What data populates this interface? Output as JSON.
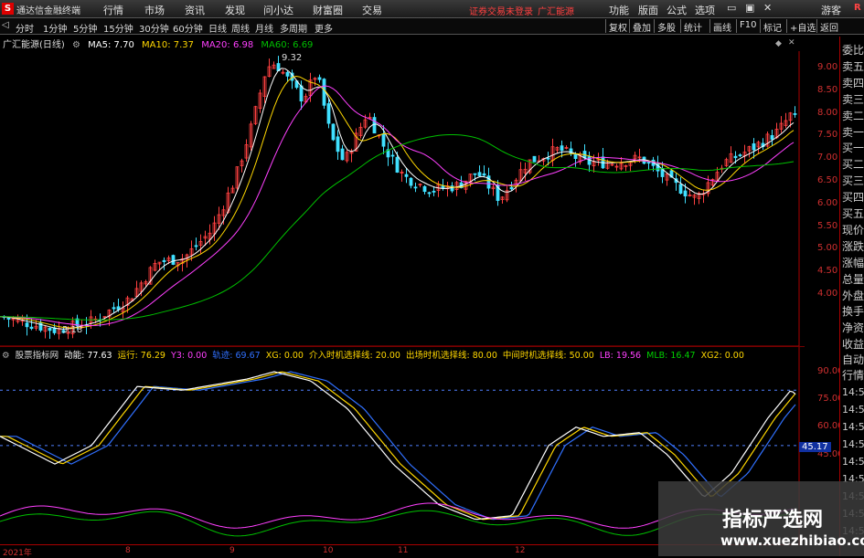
{
  "menubar": {
    "app_name": "通达信金融终端",
    "menu": [
      "行情",
      "市场",
      "资讯",
      "发现",
      "问小达",
      "财富圈",
      "交易"
    ],
    "warning1": "证券交易未登录",
    "warning2": "广汇能源",
    "right_menu": [
      "功能",
      "版面",
      "公式",
      "选项"
    ],
    "right_extra": "游客"
  },
  "toolbar": {
    "periods": [
      "分时",
      "1分钟",
      "5分钟",
      "15分钟",
      "30分钟",
      "60分钟",
      "日线",
      "周线",
      "月线",
      "多周期",
      "更多"
    ],
    "right_buttons": [
      "复权",
      "叠加",
      "多股",
      "统计",
      "画线",
      "F10",
      "标记",
      "+自选",
      "返回"
    ]
  },
  "main_chart": {
    "stock_name": "广汇能源(日线)",
    "ma5": "MA5: 7.70",
    "ma10": "MA10: 7.37",
    "ma20": "MA20: 6.98",
    "ma60": "MA60: 6.69",
    "high_label": "9.32",
    "low_label": "3.18",
    "y_ticks": [
      "9.00",
      "8.50",
      "8.00",
      "7.50",
      "7.00",
      "6.50",
      "6.00",
      "5.50",
      "5.00",
      "4.50",
      "4.00"
    ],
    "colors": {
      "ma5": "#ffffff",
      "ma10": "#ffd700",
      "ma20": "#ff40ff",
      "ma60": "#00c000",
      "up": "#ff4040",
      "down": "#40e0ff"
    }
  },
  "indicator": {
    "name": "股票指标网",
    "items": [
      {
        "label": "动能: 77.63",
        "color": "#ffffff"
      },
      {
        "label": "运行: 76.29",
        "color": "#ffd700"
      },
      {
        "label": "Y3: 0.00",
        "color": "#ff40ff"
      },
      {
        "label": "轨迹: 69.67",
        "color": "#3070ff"
      },
      {
        "label": "XG: 0.00",
        "color": "#ffd700"
      },
      {
        "label": "介入时机选择线: 20.00",
        "color": "#ffd700"
      },
      {
        "label": "出场时机选择线: 80.00",
        "color": "#ffd700"
      },
      {
        "label": "中间时机选择线: 50.00",
        "color": "#ffd700"
      },
      {
        "label": "LB: 19.56",
        "color": "#ff40ff"
      },
      {
        "label": "MLB: 16.47",
        "color": "#00d000"
      },
      {
        "label": "XG2: 0.00",
        "color": "#ffd700"
      }
    ],
    "y_ticks": [
      "90.00",
      "75.00",
      "60.00",
      "45.00"
    ],
    "badge": "45.17"
  },
  "sidebar": {
    "items": [
      "委比",
      "卖五",
      "卖四",
      "卖三",
      "卖二",
      "卖一",
      "买一",
      "买二",
      "买三",
      "买四",
      "买五",
      "现价",
      "涨跌",
      "涨幅",
      "总量",
      "外盘",
      "换手",
      "净资",
      "收益"
    ],
    "lower_items": [
      "自动",
      "行情"
    ],
    "times": [
      "14:5",
      "14:5",
      "14:5",
      "14:5",
      "14:5",
      "14:5",
      "14:5",
      "14:5",
      "14:5"
    ]
  },
  "x_axis": [
    "2021年",
    "8",
    "9",
    "10",
    "11",
    "12"
  ],
  "watermark": {
    "title": "指标严选网",
    "url": "www.xuezhibiao.com"
  }
}
